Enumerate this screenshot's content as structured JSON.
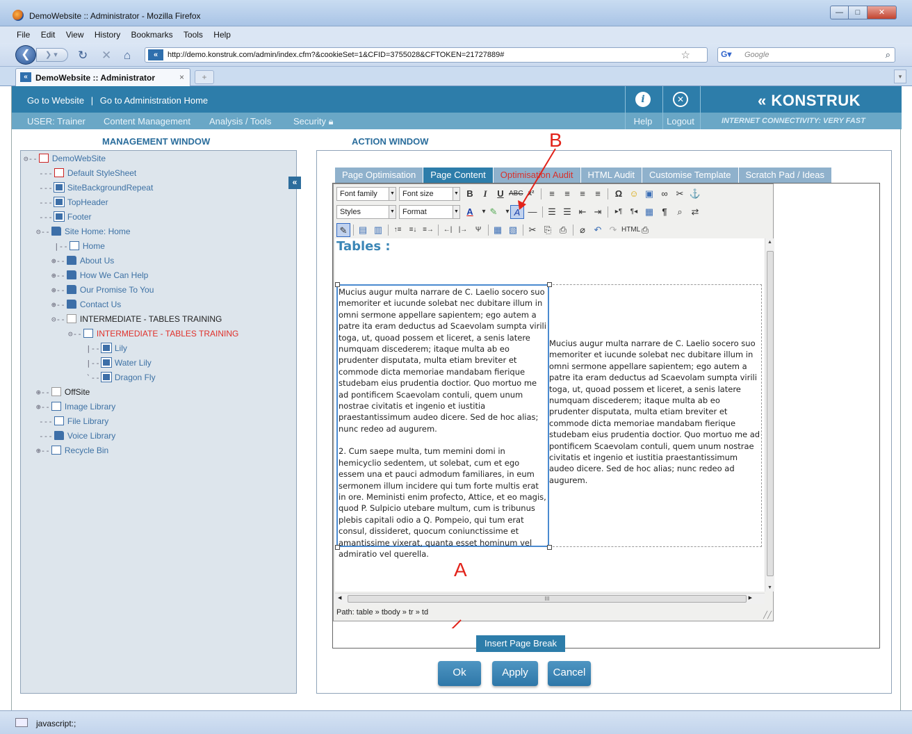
{
  "browser": {
    "window_title": "DemoWebsite :: Administrator - Mozilla Firefox",
    "menu": [
      "File",
      "Edit",
      "View",
      "History",
      "Bookmarks",
      "Tools",
      "Help"
    ],
    "url": "http://demo.konstruk.com/admin/index.cfm?&cookieSet=1&CFID=3755028&CFTOKEN=21727889#",
    "search_placeholder": "Google",
    "tab_title": "DemoWebsite :: Administrator",
    "status_text": "javascript:;"
  },
  "header": {
    "goto_website": "Go to Website",
    "separator": "|",
    "goto_admin": "Go to Administration Home",
    "user": "USER: Trainer",
    "content_mgmt": "Content Management",
    "analysis": "Analysis / Tools",
    "security": "Security",
    "help": "Help",
    "logout": "Logout",
    "brand": "KONSTRUK",
    "tagline": "INTERNET CONNECTIVITY: VERY FAST"
  },
  "management": {
    "title": "MANAGEMENT WINDOW",
    "tree": [
      {
        "label": "DemoWebSite",
        "style": "blue"
      },
      {
        "label": "Default StyleSheet",
        "style": "blue"
      },
      {
        "label": "SiteBackgroundRepeat",
        "style": "blue"
      },
      {
        "label": "TopHeader",
        "style": "blue"
      },
      {
        "label": "Footer",
        "style": "blue"
      },
      {
        "label": "Site Home: Home",
        "style": "blue"
      },
      {
        "label": "Home",
        "style": "blue"
      },
      {
        "label": "About Us",
        "style": "blue"
      },
      {
        "label": "How We Can Help",
        "style": "blue"
      },
      {
        "label": "Our Promise To You",
        "style": "blue"
      },
      {
        "label": "Contact Us",
        "style": "blue"
      },
      {
        "label": "INTERMEDIATE - TABLES TRAINING",
        "style": "dark"
      },
      {
        "label": "INTERMEDIATE - TABLES TRAINING",
        "style": "red"
      },
      {
        "label": "Lily",
        "style": "blue"
      },
      {
        "label": "Water Lily",
        "style": "blue"
      },
      {
        "label": "Dragon Fly",
        "style": "blue"
      },
      {
        "label": "OffSite",
        "style": "dark"
      },
      {
        "label": "Image Library",
        "style": "blue"
      },
      {
        "label": "File Library",
        "style": "blue"
      },
      {
        "label": "Voice Library",
        "style": "blue"
      },
      {
        "label": "Recycle Bin",
        "style": "blue"
      }
    ]
  },
  "action": {
    "title": "ACTION WINDOW",
    "tabs": [
      "Page Optimisation",
      "Page Content",
      "Optimisation Audit",
      "HTML Audit",
      "Customise Template",
      "Scratch Pad / Ideas"
    ],
    "toolbar": {
      "font_family": "Font family",
      "font_size": "Font size",
      "styles": "Styles",
      "format": "Format"
    },
    "content": {
      "heading": "Tables :",
      "cell1_p1": "Mucius augur multa narrare de C. Laelio socero suo memoriter et iucunde solebat nec dubitare illum in omni sermone appellare sapientem; ego autem a patre ita eram deductus ad Scaevolam sumpta virili toga, ut, quoad possem et liceret, a senis latere numquam discederem; itaque multa ab eo prudenter disputata, multa etiam breviter et commode dicta memoriae mandabam fierique studebam eius prudentia doctior. Quo mortuo me ad pontificem Scaevolam contuli, quem unum nostrae civitatis et ingenio et iustitia praestantissimum audeo dicere. Sed de hoc alias; nunc redeo ad augurem.",
      "cell1_p2": "2. Cum saepe multa, tum memini domi in hemicyclio sedentem, ut solebat, cum et ego essem una et pauci admodum familiares, in eum sermonem illum incidere qui tum forte multis erat in ore. Meministi enim profecto, Attice, et eo magis, quod P. Sulpicio utebare multum, cum is tribunus plebis capitali odio a Q. Pompeio, qui tum erat consul, dissideret, quocum coniunctissime et amantissime vixerat, quanta esset hominum vel admiratio vel querella.",
      "cell2_p1": "Mucius augur multa narrare de C. Laelio socero suo memoriter et iucunde solebat nec dubitare illum in omni sermone appellare sapientem; ego autem a patre ita eram deductus ad Scaevolam sumpta virili toga, ut, quoad possem et liceret, a senis latere numquam discederem; itaque multa ab eo prudenter disputata, multa etiam breviter et commode dicta memoriae mandabam fierique studebam eius prudentia doctior. Quo mortuo me ad pontificem Scaevolam contuli, quem unum nostrae civitatis et ingenio et iustitia praestantissimum audeo dicere. Sed de hoc alias; nunc redeo ad augurem."
    },
    "path": "Path: table » tbody » tr » td",
    "insert_break": "Insert Page Break",
    "ok": "Ok",
    "apply": "Apply",
    "cancel": "Cancel"
  },
  "annotations": {
    "a": "A",
    "b": "B"
  }
}
